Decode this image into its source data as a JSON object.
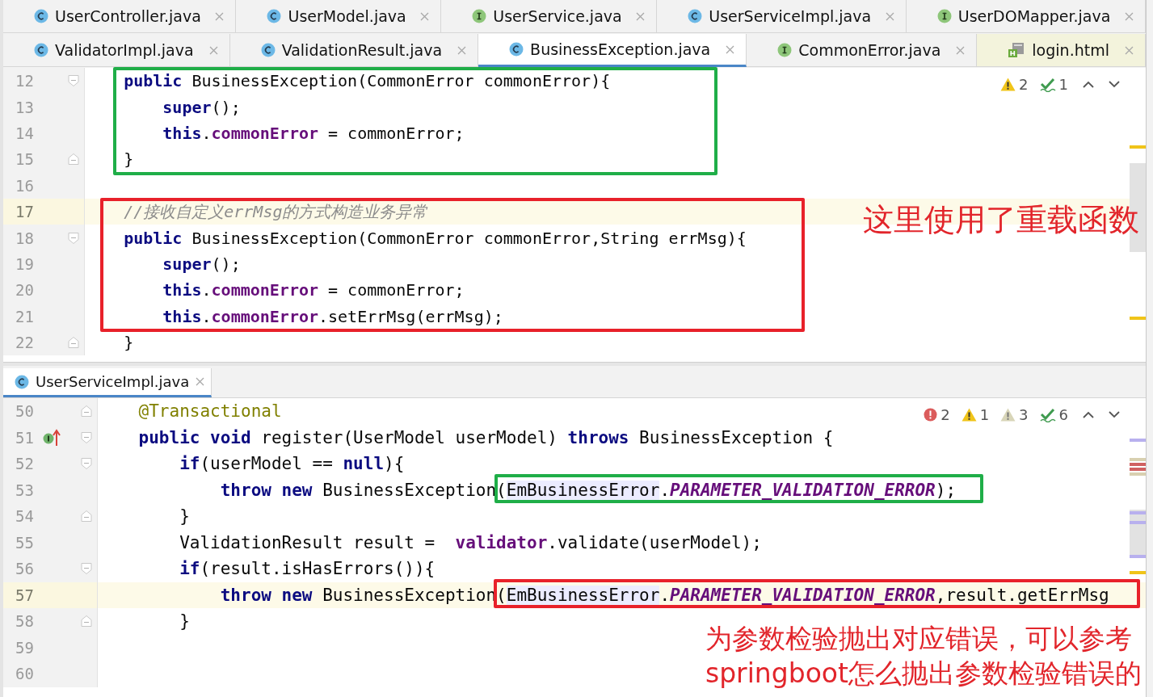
{
  "tab_rows": [
    [
      {
        "label": "UserController.java",
        "kind": "class",
        "selected": false
      },
      {
        "label": "UserModel.java",
        "kind": "class",
        "selected": false
      },
      {
        "label": "UserService.java",
        "kind": "interface",
        "selected": false
      },
      {
        "label": "UserServiceImpl.java",
        "kind": "class",
        "selected": false
      },
      {
        "label": "UserDOMapper.java",
        "kind": "interface",
        "selected": false
      }
    ],
    [
      {
        "label": "ValidatorImpl.java",
        "kind": "class",
        "selected": false
      },
      {
        "label": "ValidationResult.java",
        "kind": "class",
        "selected": false
      },
      {
        "label": "BusinessException.java",
        "kind": "class",
        "selected": true
      },
      {
        "label": "CommonError.java",
        "kind": "interface",
        "selected": false
      },
      {
        "label": "login.html",
        "kind": "html",
        "selected": false
      }
    ]
  ],
  "top_editor": {
    "inspections": [
      {
        "kind": "warning",
        "count": "2"
      },
      {
        "kind": "typo",
        "count": "1"
      }
    ],
    "lines": [
      {
        "number": "12",
        "current": false,
        "fold_marker": {
          "kind": "start"
        },
        "tokens": [
          {
            "t": "    public",
            "kind": "keyword"
          },
          {
            "t": " BusinessException(CommonError commonError){"
          }
        ]
      },
      {
        "number": "13",
        "current": false,
        "tokens": [
          {
            "t": "        super",
            "kind": "keyword"
          },
          {
            "t": "();"
          }
        ]
      },
      {
        "number": "14",
        "current": false,
        "tokens": [
          {
            "t": "        this",
            "kind": "keyword"
          },
          {
            "t": "."
          },
          {
            "t": "commonError",
            "kind": "field"
          },
          {
            "t": " = commonError;"
          }
        ]
      },
      {
        "number": "15",
        "current": false,
        "fold_marker": {
          "kind": "end"
        },
        "tokens": [
          {
            "t": "    }"
          }
        ]
      },
      {
        "number": "16",
        "current": false
      },
      {
        "number": "17",
        "current": true,
        "tokens": [
          {
            "t": "    //接收自定义errMsg的方式构造业务异常",
            "kind": "comment"
          }
        ]
      },
      {
        "number": "18",
        "current": false,
        "fold_marker": {
          "kind": "start"
        },
        "tokens": [
          {
            "t": "    public",
            "kind": "keyword"
          },
          {
            "t": " BusinessException(CommonError commonError,String errMsg){"
          }
        ]
      },
      {
        "number": "19",
        "current": false,
        "tokens": [
          {
            "t": "        super",
            "kind": "keyword"
          },
          {
            "t": "();"
          }
        ]
      },
      {
        "number": "20",
        "current": false,
        "tokens": [
          {
            "t": "        this",
            "kind": "keyword"
          },
          {
            "t": "."
          },
          {
            "t": "commonError",
            "kind": "field"
          },
          {
            "t": " = commonError;"
          }
        ]
      },
      {
        "number": "21",
        "current": false,
        "tokens": [
          {
            "t": "        this",
            "kind": "keyword"
          },
          {
            "t": "."
          },
          {
            "t": "commonError",
            "kind": "field"
          },
          {
            "t": ".setErrMsg(errMsg);"
          }
        ]
      },
      {
        "number": "22",
        "current": false,
        "fold_marker": {
          "kind": "end"
        },
        "tokens": [
          {
            "t": "    }"
          }
        ]
      }
    ],
    "annotations": [
      {
        "kind": "green-frame"
      },
      {
        "kind": "red-frame"
      },
      {
        "kind": "note",
        "text": "这里使用了重载函数"
      }
    ]
  },
  "bottom_tab": {
    "label": "UserServiceImpl.java",
    "kind": "class",
    "selected": true
  },
  "bottom_editor": {
    "inspections": [
      {
        "kind": "error",
        "count": "2"
      },
      {
        "kind": "warning",
        "count": "1"
      },
      {
        "kind": "weak",
        "count": "3"
      },
      {
        "kind": "typo",
        "count": "6"
      }
    ],
    "lines": [
      {
        "number": "50",
        "current": false,
        "fold_marker": {
          "kind": "end"
        },
        "tokens": [
          {
            "t": "    @Transactional",
            "kind": "annotation"
          }
        ]
      },
      {
        "number": "51",
        "current": false,
        "fold_marker": {
          "kind": "start"
        },
        "gutter_icon": {
          "kind": "implements"
        },
        "tokens": [
          {
            "t": "    public",
            "kind": "keyword"
          },
          {
            "t": " void",
            "kind": "keyword"
          },
          {
            "t": " register(UserModel userModel) "
          },
          {
            "t": "throws",
            "kind": "keyword"
          },
          {
            "t": " BusinessException {"
          }
        ]
      },
      {
        "number": "52",
        "current": false,
        "fold_marker": {
          "kind": "start"
        },
        "tokens": [
          {
            "t": "        if",
            "kind": "keyword"
          },
          {
            "t": "(userModel == "
          },
          {
            "t": "null",
            "kind": "keyword"
          },
          {
            "t": "){"
          }
        ]
      },
      {
        "number": "53",
        "current": false,
        "tokens": [
          {
            "t": "            throw",
            "kind": "keyword"
          },
          {
            "t": " new",
            "kind": "keyword"
          },
          {
            "t": " BusinessException("
          },
          {
            "t": "EmBusinessError",
            "kind": "reference"
          },
          {
            "t": "."
          },
          {
            "t": "PARAMETER_VALIDATION_ERROR",
            "kind": "constant"
          },
          {
            "t": ");"
          }
        ]
      },
      {
        "number": "54",
        "current": false,
        "fold_marker": {
          "kind": "end"
        },
        "tokens": [
          {
            "t": "        }"
          }
        ]
      },
      {
        "number": "55",
        "current": false,
        "tokens": [
          {
            "t": "        ValidationResult result =  "
          },
          {
            "t": "validator",
            "kind": "field"
          },
          {
            "t": ".validate(userModel);"
          }
        ]
      },
      {
        "number": "56",
        "current": false,
        "fold_marker": {
          "kind": "start"
        },
        "tokens": [
          {
            "t": "        if",
            "kind": "keyword"
          },
          {
            "t": "(result.isHasErrors()){"
          }
        ]
      },
      {
        "number": "57",
        "current": true,
        "tokens": [
          {
            "t": "            throw",
            "kind": "keyword"
          },
          {
            "t": " new",
            "kind": "keyword"
          },
          {
            "t": " BusinessException("
          },
          {
            "t": "EmBusinessError",
            "kind": "reference"
          },
          {
            "t": "."
          },
          {
            "t": "PARAMETER_VALIDATION_ERROR",
            "kind": "constant"
          },
          {
            "t": ",result.getErrMsg"
          }
        ]
      },
      {
        "number": "58",
        "current": false,
        "fold_marker": {
          "kind": "end"
        },
        "tokens": [
          {
            "t": "        }"
          }
        ]
      },
      {
        "number": "59",
        "current": false
      },
      {
        "number": "60",
        "current": false
      }
    ],
    "annotations": [
      {
        "kind": "green-frame"
      },
      {
        "kind": "red-frame"
      },
      {
        "kind": "note",
        "text": "为参数检验抛出对应错误，可以参考\nspringboot怎么抛出参数检验错误的"
      }
    ]
  }
}
